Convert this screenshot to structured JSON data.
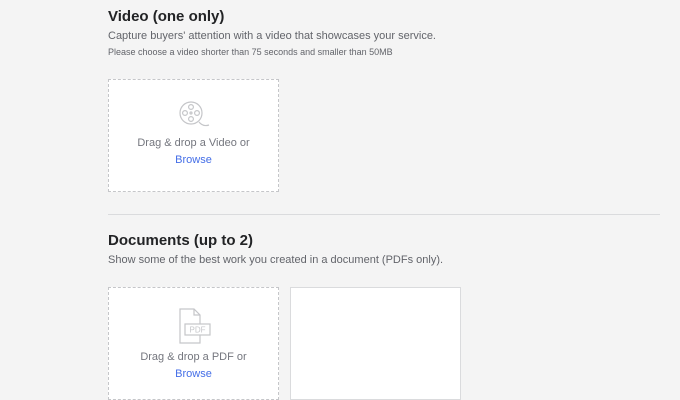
{
  "video_section": {
    "title": "Video (one only)",
    "description": "Capture buyers' attention with a video that showcases your service.",
    "note": "Please choose a video shorter than 75 seconds and smaller than 50MB",
    "dropzone": {
      "icon": "film-reel-icon",
      "text": "Drag & drop a Video or",
      "link": "Browse"
    }
  },
  "documents_section": {
    "title": "Documents (up to 2)",
    "description": "Show some of the best work you created in a document (PDFs only).",
    "dropzone": {
      "icon": "pdf-file-icon",
      "icon_label": "PDF",
      "text": "Drag & drop a PDF or",
      "link": "Browse"
    }
  },
  "colors": {
    "accent": "#446ee7",
    "background": "#f4f4f4"
  }
}
